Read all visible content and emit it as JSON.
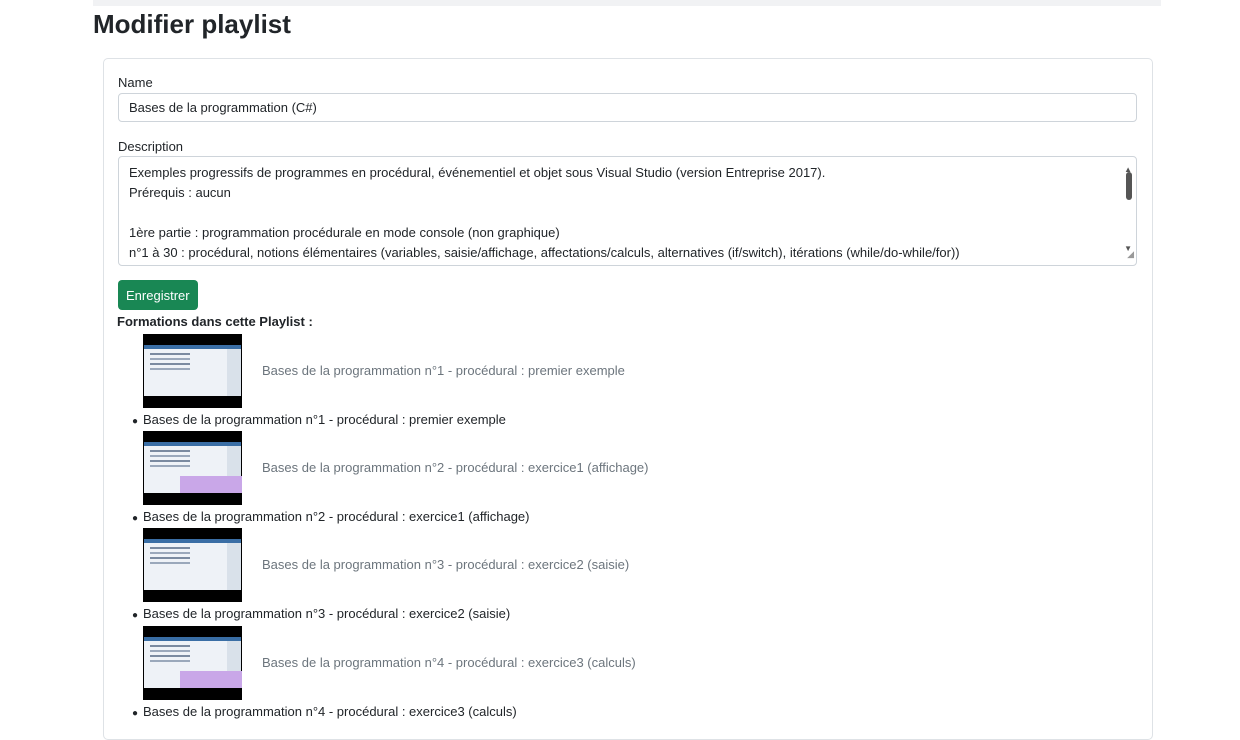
{
  "page_title": "Modifier playlist",
  "form": {
    "name_label": "Name",
    "name_value": "Bases de la programmation (C#)",
    "description_label": "Description",
    "description_lines": [
      "Exemples progressifs de programmes en procédural, événementiel et objet sous Visual Studio (version Entreprise 2017).",
      "Prérequis : aucun",
      "",
      "1ère partie : programmation procédurale en mode console (non graphique)",
      "n°1 à 30 : procédural, notions élémentaires (variables, saisie/affichage, affectations/calculs, alternatives (if/switch), itérations (while/do-while/for))"
    ],
    "submit_label": "Enregistrer"
  },
  "formations": {
    "heading": "Formations dans cette Playlist :",
    "items": [
      {
        "thumb_title": "Bases de la programmation n°1 - procédural : premier exemple",
        "label": "Bases de la programmation n°1 - procédural : premier exemple"
      },
      {
        "thumb_title": "Bases de la programmation n°2 - procédural : exercice1 (affichage)",
        "label": "Bases de la programmation n°2 - procédural : exercice1 (affichage)"
      },
      {
        "thumb_title": "Bases de la programmation n°3 - procédural : exercice2 (saisie)",
        "label": "Bases de la programmation n°3 - procédural : exercice2 (saisie)"
      },
      {
        "thumb_title": "Bases de la programmation n°4 - procédural : exercice3 (calculs)",
        "label": "Bases de la programmation n°4 - procédural : exercice3 (calculs)"
      }
    ]
  }
}
